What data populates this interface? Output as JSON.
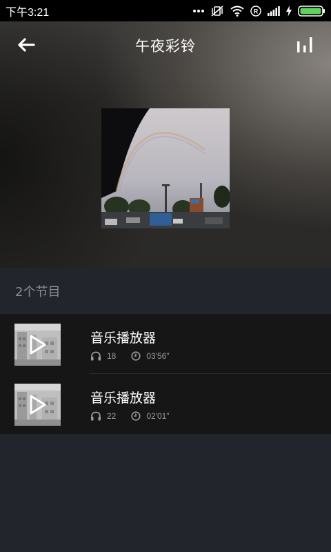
{
  "status_bar": {
    "time": "下午3:21",
    "icons": [
      "more-dots-icon",
      "vibrate-off-icon",
      "wifi-icon",
      "roaming-r-icon",
      "signal-icon",
      "charging-icon",
      "battery-icon"
    ],
    "battery_color": "#5fd35f"
  },
  "header": {
    "title": "午夜彩铃",
    "back_icon": "arrow-left-icon",
    "chart_icon": "bar-chart-icon"
  },
  "section": {
    "count_label": "2个节目"
  },
  "programs": [
    {
      "title": "音乐播放器",
      "plays": "18",
      "duration": "03'56\""
    },
    {
      "title": "音乐播放器",
      "plays": "22",
      "duration": "02'01\""
    }
  ]
}
